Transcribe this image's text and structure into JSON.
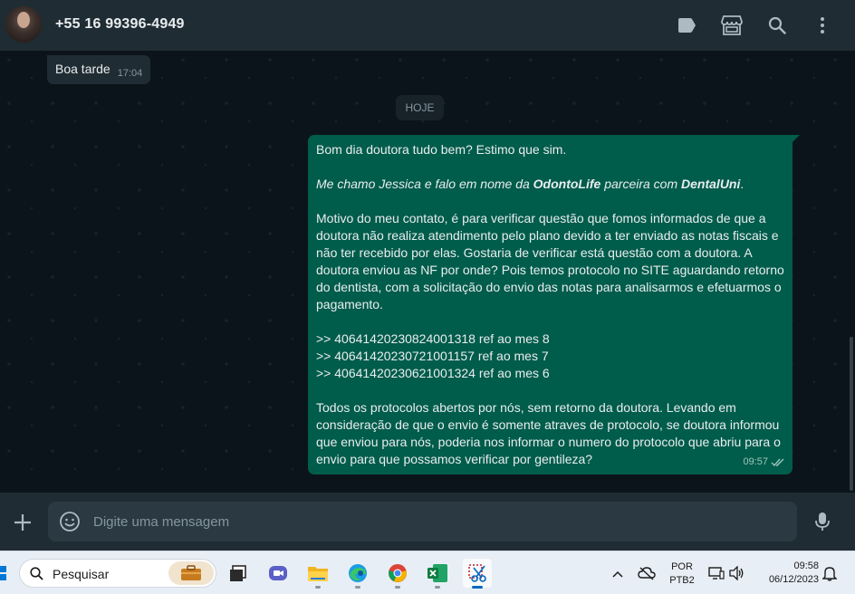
{
  "header": {
    "contact_name": "+55 16 99396-4949",
    "icons": [
      "label-icon",
      "store-icon",
      "search-icon",
      "menu-icon"
    ]
  },
  "chat": {
    "incoming": {
      "text": "Boa tarde",
      "time": "17:04"
    },
    "date_chip": "HOJE",
    "outgoing": {
      "line1": "Bom dia doutora tudo bem? Estimo que sim.",
      "intro_pre": "Me chamo Jessica e falo em nome da ",
      "intro_brand1": "OdontoLife",
      "intro_mid": " parceira com ",
      "intro_brand2": "DentalUni",
      "intro_end": ".",
      "para2": "Motivo do meu contato, é para verificar questão que fomos informados de que a doutora não realiza atendimento pelo plano devido a ter enviado as notas fiscais e não ter recebido por elas. Gostaria de verificar está questão com a doutora. A doutora enviou as NF por onde? Pois temos protocolo no SITE aguardando retorno do dentista, com a solicitação do envio das notas para analisarmos e efetuarmos o pagamento.",
      "protocols": [
        ">> 40641420230824001318 ref ao mes 8",
        ">> 40641420230721001157 ref ao mes 7",
        ">> 40641420230621001324 ref ao mes 6"
      ],
      "para3": "Todos os protocolos abertos por nós, sem retorno da doutora. Levando em consideração de que o envio é somente atraves de protocolo, se doutora informou que enviou para nós, poderia nos informar o numero do protocolo que abriu para o envio para que possamos verificar por gentileza?",
      "time": "09:57",
      "status": "read"
    }
  },
  "composer": {
    "placeholder": "Digite uma mensagem"
  },
  "taskbar": {
    "search_placeholder": "Pesquisar",
    "apps": [
      "briefcase-icon",
      "task-view-icon",
      "teams-icon",
      "file-explorer-icon",
      "edge-icon",
      "chrome-icon",
      "excel-icon",
      "snipping-tool-icon"
    ],
    "lang_line1": "POR",
    "lang_line2": "PTB2",
    "time": "09:58",
    "date": "06/12/2023"
  },
  "colors": {
    "app_bg": "#0b141a",
    "header_bg": "#202c33",
    "outgoing_bubble": "#005c4b",
    "incoming_bubble": "#202c33",
    "text": "#e9edef",
    "muted": "#8696a0"
  }
}
